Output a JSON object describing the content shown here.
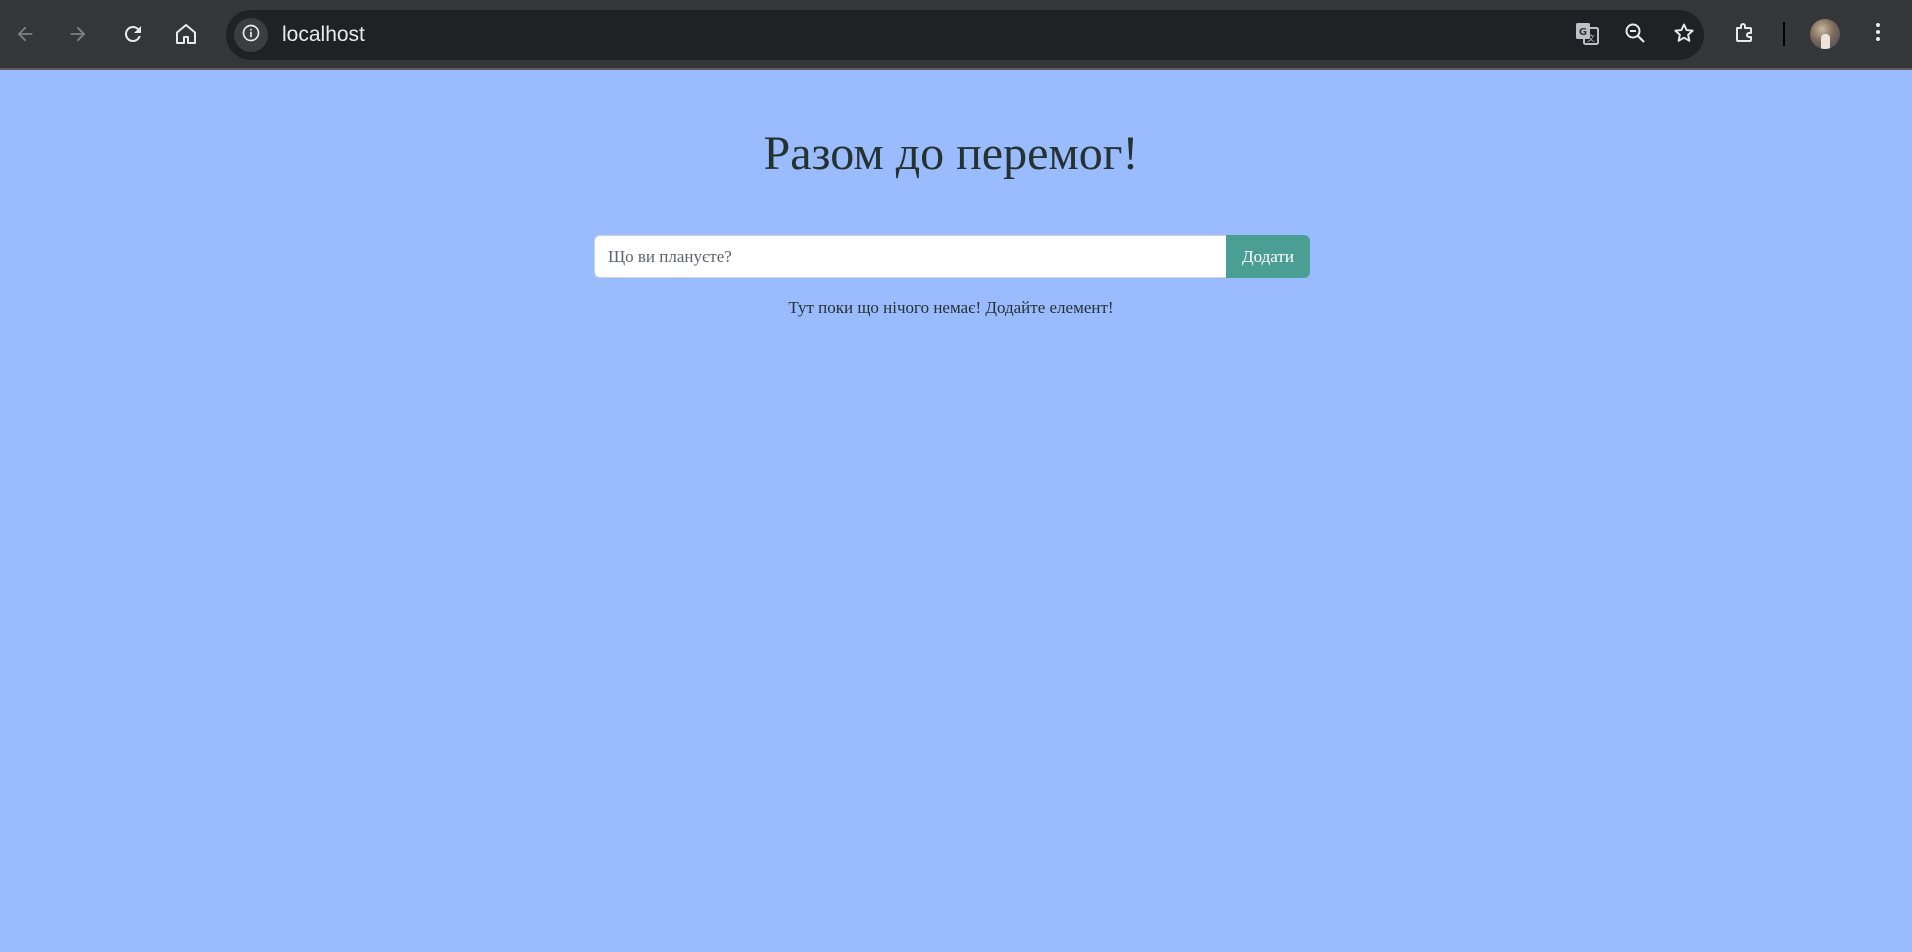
{
  "browser": {
    "url": "localhost",
    "icons": {
      "back": "arrow-left-icon",
      "forward": "arrow-right-icon",
      "reload": "reload-icon",
      "home": "home-icon",
      "site_info": "info-icon",
      "translate": "translate-icon",
      "zoom": "zoom-out-icon",
      "bookmark": "star-icon",
      "extensions": "puzzle-icon",
      "menu": "kebab-menu-icon"
    }
  },
  "page": {
    "title": "Разом до перемог!",
    "input_placeholder": "Що ви плануєте?",
    "add_button_label": "Додати",
    "empty_message": "Тут поки що нічого немає! Додайте елемент!"
  },
  "colors": {
    "background": "#9abbfd",
    "button": "#4a9e93",
    "chrome": "#35363a",
    "omnibox": "#202124"
  }
}
